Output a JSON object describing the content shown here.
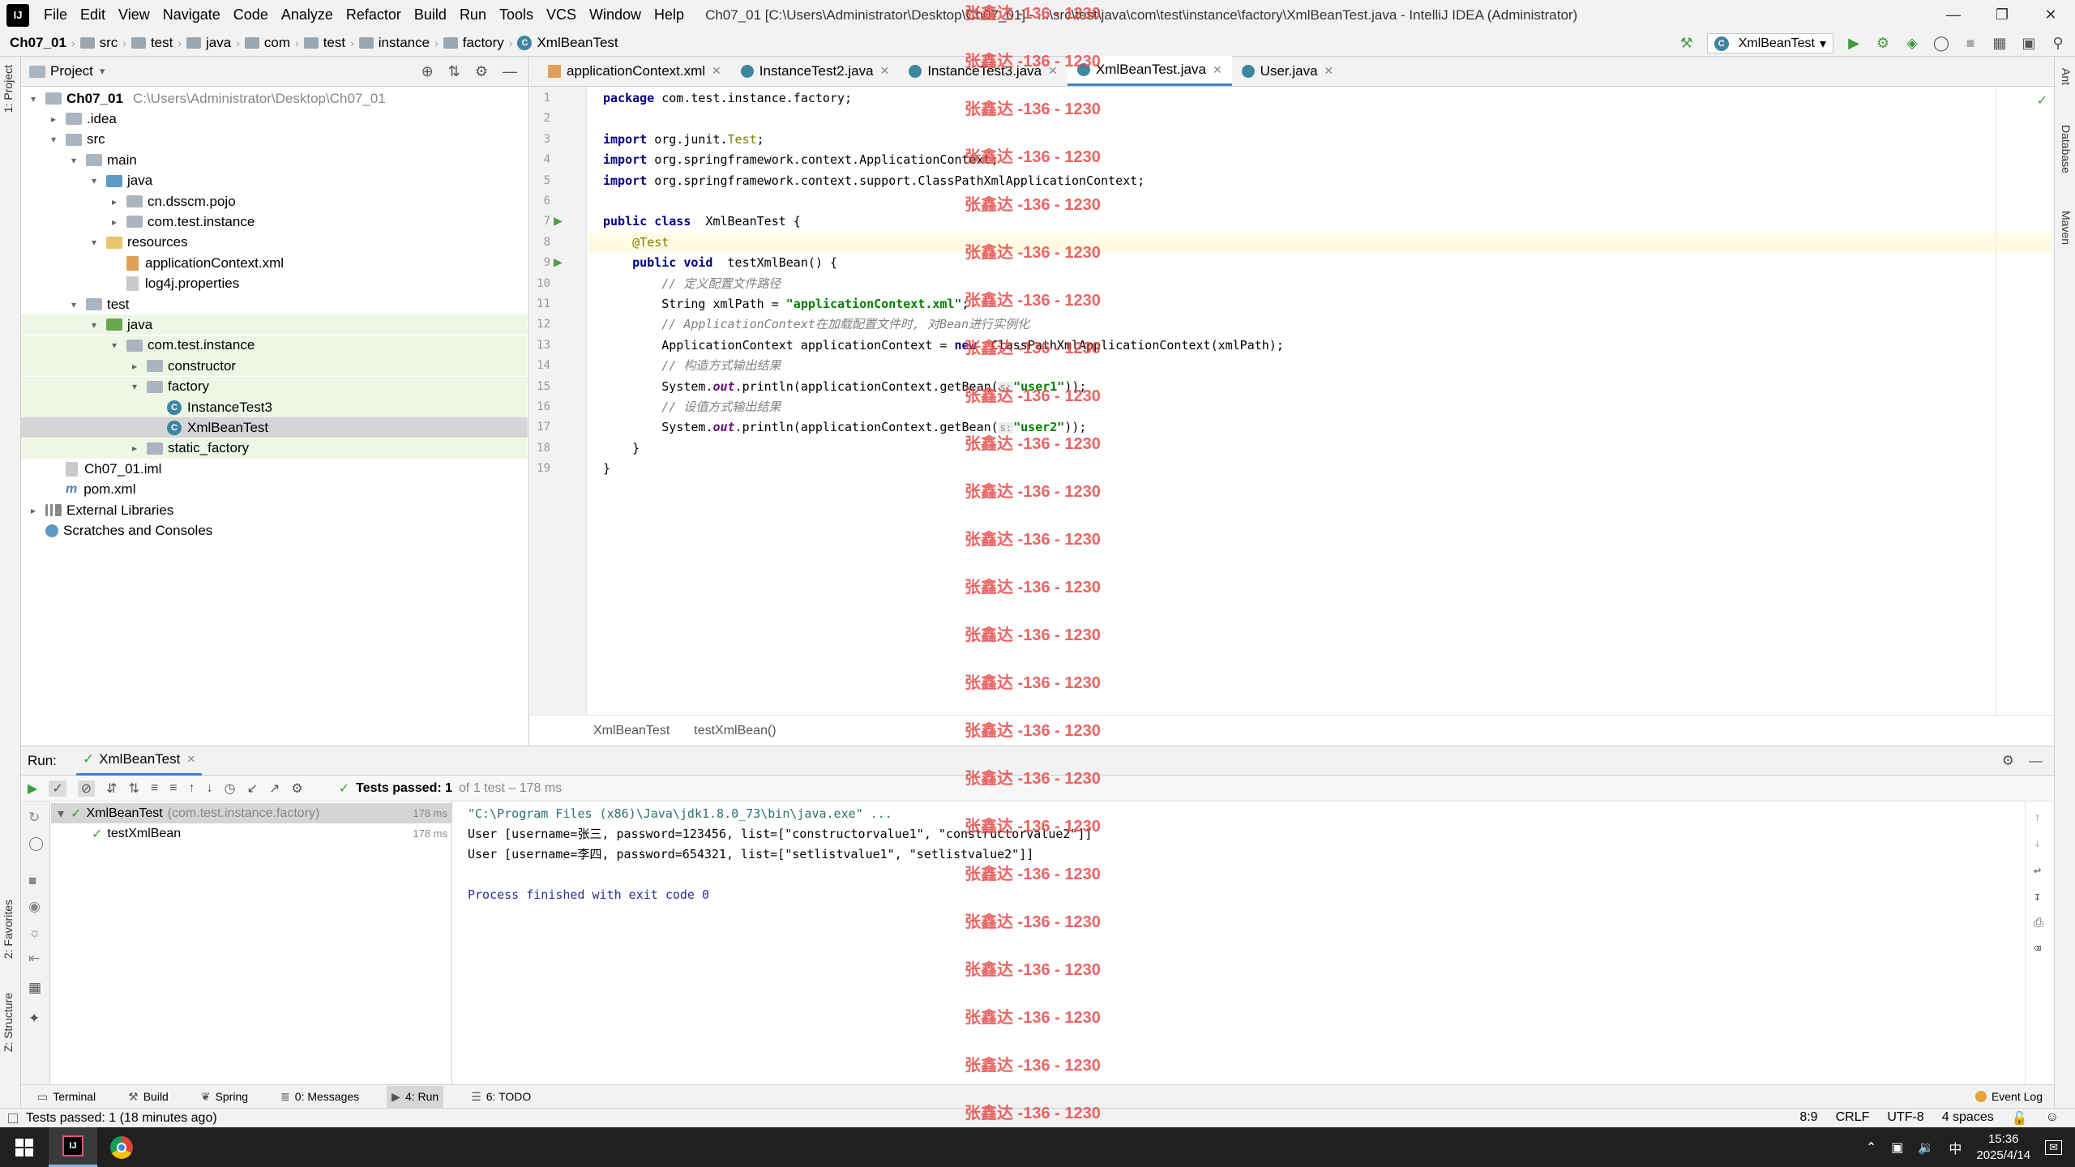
{
  "titlebar": {
    "menu": [
      "File",
      "Edit",
      "View",
      "Navigate",
      "Code",
      "Analyze",
      "Refactor",
      "Build",
      "Run",
      "Tools",
      "VCS",
      "Window",
      "Help"
    ],
    "window_title": "Ch07_01 [C:\\Users\\Administrator\\Desktop\\Ch07_01] - ...\\src\\test\\java\\com\\test\\instance\\factory\\XmlBeanTest.java - IntelliJ IDEA (Administrator)",
    "app_logo": "IJ"
  },
  "breadcrumb": [
    "Ch07_01",
    "src",
    "test",
    "java",
    "com",
    "test",
    "instance",
    "factory",
    "XmlBeanTest"
  ],
  "run_config": "XmlBeanTest",
  "project": {
    "header": "Project",
    "tree": [
      {
        "label": "Ch07_01",
        "extra": "C:\\Users\\Administrator\\Desktop\\Ch07_01",
        "depth": 0,
        "chev": "▾",
        "icon": "folder",
        "bold": true
      },
      {
        "label": ".idea",
        "depth": 1,
        "chev": "▸",
        "icon": "folder"
      },
      {
        "label": "src",
        "depth": 1,
        "chev": "▾",
        "icon": "folder"
      },
      {
        "label": "main",
        "depth": 2,
        "chev": "▾",
        "icon": "folder"
      },
      {
        "label": "java",
        "depth": 3,
        "chev": "▾",
        "icon": "folder-blue"
      },
      {
        "label": "cn.dsscm.pojo",
        "depth": 4,
        "chev": "▸",
        "icon": "folder"
      },
      {
        "label": "com.test.instance",
        "depth": 4,
        "chev": "▸",
        "icon": "folder"
      },
      {
        "label": "resources",
        "depth": 3,
        "chev": "▾",
        "icon": "folder-yellow"
      },
      {
        "label": "applicationContext.xml",
        "depth": 4,
        "chev": "",
        "icon": "xml"
      },
      {
        "label": "log4j.properties",
        "depth": 4,
        "chev": "",
        "icon": "file"
      },
      {
        "label": "test",
        "depth": 2,
        "chev": "▾",
        "icon": "folder"
      },
      {
        "label": "java",
        "depth": 3,
        "chev": "▾",
        "icon": "folder-green",
        "test": true
      },
      {
        "label": "com.test.instance",
        "depth": 4,
        "chev": "▾",
        "icon": "folder",
        "test": true
      },
      {
        "label": "constructor",
        "depth": 5,
        "chev": "▸",
        "icon": "folder",
        "test": true
      },
      {
        "label": "factory",
        "depth": 5,
        "chev": "▾",
        "icon": "folder",
        "test": true
      },
      {
        "label": "InstanceTest3",
        "depth": 6,
        "chev": "",
        "icon": "class",
        "test": true
      },
      {
        "label": "XmlBeanTest",
        "depth": 6,
        "chev": "",
        "icon": "class",
        "sel": true
      },
      {
        "label": "static_factory",
        "depth": 5,
        "chev": "▸",
        "icon": "folder",
        "test": true
      },
      {
        "label": "Ch07_01.iml",
        "depth": 1,
        "chev": "",
        "icon": "file"
      },
      {
        "label": "pom.xml",
        "depth": 1,
        "chev": "",
        "icon": "pom"
      },
      {
        "label": "External Libraries",
        "depth": 0,
        "chev": "▸",
        "icon": "lib"
      },
      {
        "label": "Scratches and Consoles",
        "depth": 0,
        "chev": "",
        "icon": "scratch"
      }
    ]
  },
  "editor": {
    "tabs": [
      {
        "label": "applicationContext.xml",
        "icon": "xml"
      },
      {
        "label": "InstanceTest2.java",
        "icon": "class"
      },
      {
        "label": "InstanceTest3.java",
        "icon": "class"
      },
      {
        "label": "XmlBeanTest.java",
        "icon": "class",
        "active": true
      },
      {
        "label": "User.java",
        "icon": "class"
      }
    ],
    "breadcrumb": [
      "XmlBeanTest",
      "testXmlBean()"
    ],
    "line_numbers": [
      "1",
      "2",
      "3",
      "4",
      "5",
      "6",
      "7",
      "8",
      "9",
      "10",
      "11",
      "12",
      "13",
      "14",
      "15",
      "16",
      "17",
      "18",
      "19"
    ],
    "code": [
      [
        [
          "kw",
          "package"
        ],
        [
          "",
          "com.test.instance.factory;"
        ]
      ],
      [],
      [
        [
          "kw",
          "import"
        ],
        [
          "",
          "org.junit."
        ],
        [
          "an",
          "Test"
        ],
        [
          "",
          ";"
        ]
      ],
      [
        [
          "kw",
          "import"
        ],
        [
          "",
          "org.springframework.context.ApplicationContext;"
        ]
      ],
      [
        [
          "kw",
          "import"
        ],
        [
          "",
          "org.springframework.context.support.ClassPathXmlApplicationContext;"
        ]
      ],
      [],
      [
        [
          "kw",
          "public class"
        ],
        [
          "",
          " XmlBeanTest {"
        ]
      ],
      [
        [
          "",
          "    "
        ],
        [
          "an",
          "@Test"
        ]
      ],
      [
        [
          "",
          "    "
        ],
        [
          "kw",
          "public void"
        ],
        [
          "",
          " testXmlBean() {"
        ]
      ],
      [
        [
          "",
          "        "
        ],
        [
          "cm",
          "// 定义配置文件路径"
        ]
      ],
      [
        [
          "",
          "        String xmlPath = "
        ],
        [
          "str",
          "\"applicationContext.xml\""
        ],
        [
          "",
          ";"
        ]
      ],
      [
        [
          "",
          "        "
        ],
        [
          "cm",
          "// ApplicationContext在加载配置文件时, 对Bean进行实例化"
        ]
      ],
      [
        [
          "",
          "        ApplicationContext applicationContext = "
        ],
        [
          "kw",
          "new"
        ],
        [
          "",
          " ClassPathXmlApplicationContext(xmlPath);"
        ]
      ],
      [
        [
          "",
          "        "
        ],
        [
          "cm",
          "// 构造方式输出结果"
        ]
      ],
      [
        [
          "",
          "        System."
        ],
        [
          "fld",
          "out"
        ],
        [
          "",
          ".println(applicationContext.getBean("
        ],
        [
          "hint",
          "s:"
        ],
        [
          "",
          ""
        ],
        [
          "str",
          "\"user1\""
        ],
        [
          "",
          "));"
        ]
      ],
      [
        [
          "",
          "        "
        ],
        [
          "cm",
          "// 设值方式输出结果"
        ]
      ],
      [
        [
          "",
          "        System."
        ],
        [
          "fld",
          "out"
        ],
        [
          "",
          ".println(applicationContext.getBean("
        ],
        [
          "hint",
          "s:"
        ],
        [
          "",
          ""
        ],
        [
          "str",
          "\"user2\""
        ],
        [
          "",
          "));"
        ]
      ],
      [
        [
          "",
          "    }"
        ]
      ],
      [
        [
          "",
          "}"
        ]
      ]
    ]
  },
  "run": {
    "label": "Run:",
    "tab": "XmlBeanTest",
    "status_bold": "Tests passed: 1",
    "status_rest": "of 1 test – 178 ms",
    "tree": [
      {
        "label": "XmlBeanTest",
        "pkg": "(com.test.instance.factory)",
        "time": "178 ms"
      },
      {
        "label": "testXmlBean",
        "time": "178 ms"
      }
    ],
    "console": [
      "\"C:\\Program Files (x86)\\Java\\jdk1.8.0_73\\bin\\java.exe\" ...",
      "User [username=张三, password=123456, list=[\"constructorvalue1\", \"constructorvalue2\"]]",
      "User [username=李四, password=654321, list=[\"setlistvalue1\", \"setlistvalue2\"]]",
      "",
      "Process finished with exit code 0"
    ]
  },
  "toolwindows": [
    {
      "label": "Terminal"
    },
    {
      "label": "Build"
    },
    {
      "label": "Spring"
    },
    {
      "label": "0: Messages"
    },
    {
      "label": "4: Run",
      "active": true
    },
    {
      "label": "6: TODO"
    }
  ],
  "event_log": "Event Log",
  "statusbar": {
    "message": "Tests passed: 1 (18 minutes ago)",
    "position": "8:9",
    "line_sep": "CRLF",
    "encoding": "UTF-8",
    "indent": "4 spaces"
  },
  "left_vtabs": [
    "1: Project",
    "2: Favorites",
    "Z: Structure"
  ],
  "right_vtabs": [
    "Ant",
    "Database",
    "Maven"
  ],
  "taskbar": {
    "time": "15:36",
    "date": "2025/4/14",
    "ime": "中"
  },
  "watermark": "张鑫达 -136 - 1230"
}
